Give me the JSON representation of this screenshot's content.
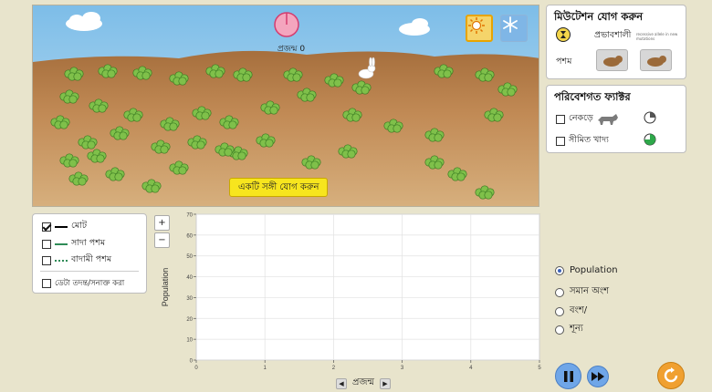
{
  "scene": {
    "generation_label": "প্রজন্ম 0",
    "add_mate_label": "একটি সঙ্গী যোগ করুন",
    "sun_icon": "sun-icon",
    "snow_icon": "snowflake-icon"
  },
  "mutation_panel": {
    "title": "মিউটেশন যোগ করুন",
    "dominant_label": "প্রভাবশালী",
    "dominant_note": "recessive allele in new mutations",
    "fur_label": "পশম"
  },
  "environment_panel": {
    "title": "পরিবেশগত ফ্যাক্টর",
    "factors": [
      {
        "label": "নেকড়ে",
        "checked": false
      },
      {
        "label": "সীমিত খাদ্য",
        "checked": false
      }
    ]
  },
  "legend": {
    "items": [
      {
        "label": "মোট",
        "checked": true,
        "color": "#000000"
      },
      {
        "label": "সাদা পশম",
        "checked": false,
        "color": "#2e8b57"
      },
      {
        "label": "বাদামী পশম",
        "checked": false,
        "color": "#2e8b57"
      }
    ],
    "probe_label": "ডেটা তদন্ত/সনাক্ত করা"
  },
  "zoom": {
    "in": "+",
    "out": "−"
  },
  "chart_data": {
    "type": "line",
    "ylabel": "Population",
    "xlabel": "প্রজন্ম",
    "xlim": [
      0,
      5
    ],
    "ylim": [
      0,
      70
    ],
    "x_ticks": [
      "0",
      "1",
      "2",
      "3",
      "4",
      "5"
    ],
    "y_ticks": [
      "0",
      "10",
      "20",
      "30",
      "40",
      "50",
      "60",
      "70"
    ],
    "grid": true,
    "series": []
  },
  "view_options": [
    {
      "label": "Population",
      "selected": true
    },
    {
      "label": "সমান অংশ",
      "selected": false
    },
    {
      "label": "বংশ/",
      "selected": false
    },
    {
      "label": "শূন্য",
      "selected": false
    }
  ],
  "colors": {
    "sky": "#93c8ea",
    "ground": "#c48a52",
    "add_mate": "#f7e51e",
    "play_button": "#6fa6e8",
    "reset_button": "#f0a030"
  }
}
